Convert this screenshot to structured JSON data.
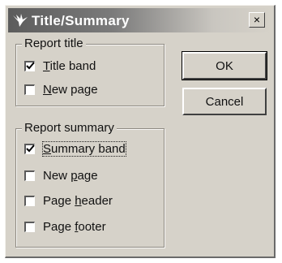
{
  "window": {
    "title": "Title/Summary",
    "close_symbol": "×"
  },
  "report_title": {
    "label": "Report title",
    "items": [
      {
        "text": "Title band",
        "checked": true,
        "accel_index": 0
      },
      {
        "text": "New page",
        "checked": false,
        "accel_index": 0
      }
    ]
  },
  "report_summary": {
    "label": "Report summary",
    "items": [
      {
        "text": "Summary band",
        "checked": true,
        "accel_index": 0
      },
      {
        "text": "New page",
        "checked": false,
        "accel_index": 4
      },
      {
        "text": "Page header",
        "checked": false,
        "accel_index": 5
      },
      {
        "text": "Page footer",
        "checked": false,
        "accel_index": 5
      }
    ]
  },
  "buttons": {
    "ok": "OK",
    "cancel": "Cancel"
  }
}
